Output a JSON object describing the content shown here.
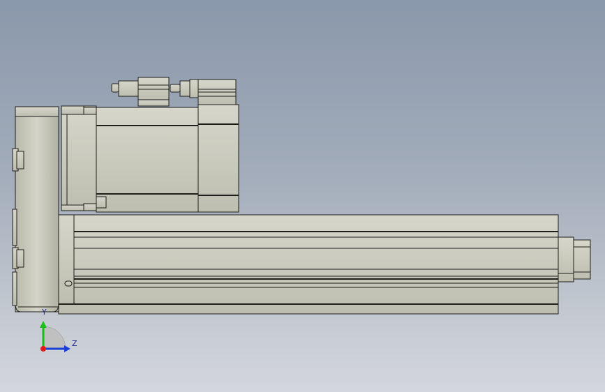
{
  "viewport": {
    "background_top": "#8a98ab",
    "background_bottom": "#d3d6dc"
  },
  "model": {
    "fill_color": "#c9c9bc",
    "edge_color": "#1e1e1a",
    "shadow_color": "#8c8c82"
  },
  "triad": {
    "y_label": "Y",
    "z_label": "Z",
    "y_color": "#18c018",
    "z_color": "#1a3fd8",
    "x_color": "#e01818"
  }
}
